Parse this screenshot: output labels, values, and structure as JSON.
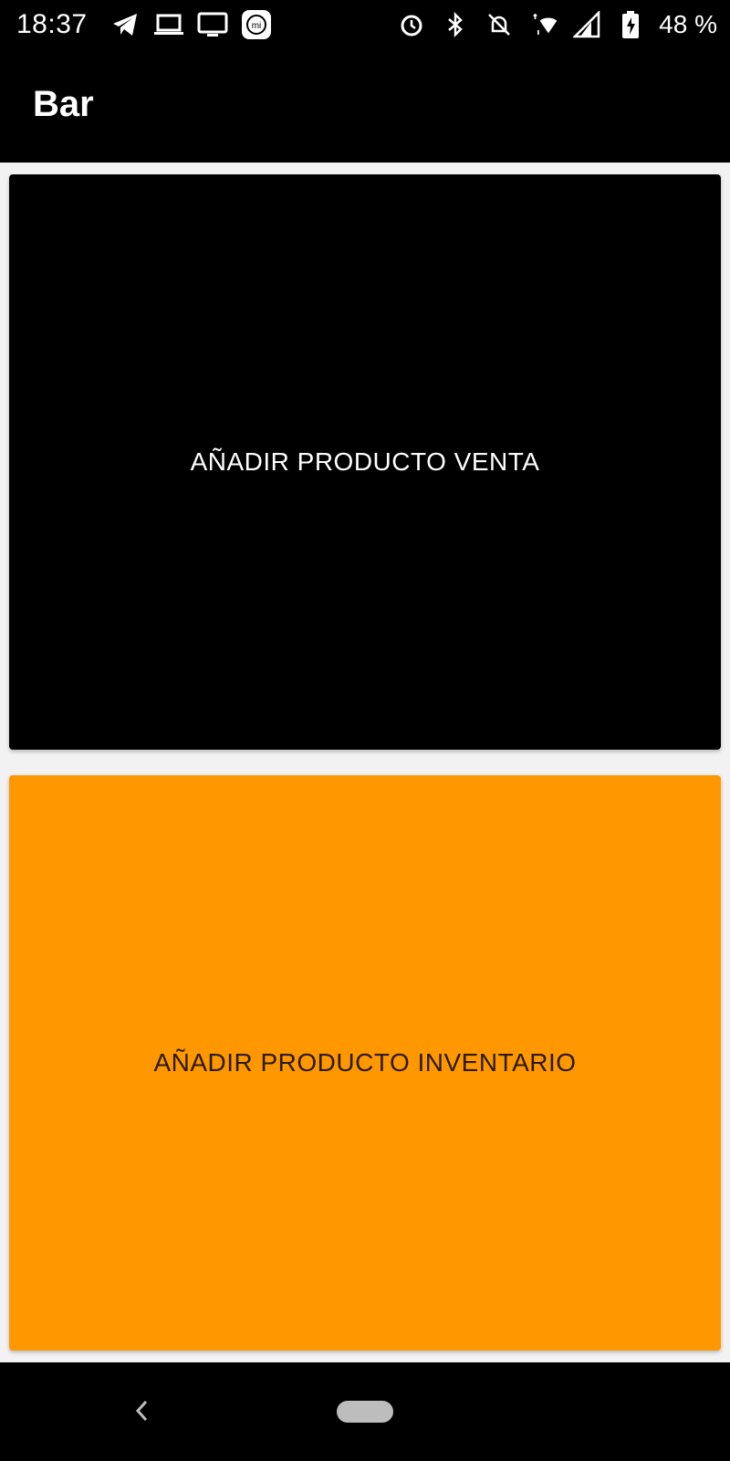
{
  "status_bar": {
    "time": "18:37",
    "battery": "48 %",
    "left_icons": [
      "telegram-icon",
      "laptop-icon",
      "monitor-icon",
      "mi-icon"
    ],
    "right_icons": [
      "alarm-icon",
      "bluetooth-icon",
      "notifications-off-icon",
      "wifi-icon",
      "signal-icon",
      "battery-icon"
    ]
  },
  "app_bar": {
    "title": "Bar"
  },
  "cards": {
    "sale": {
      "label": "AÑADIR PRODUCTO VENTA",
      "color": "#000000"
    },
    "inventory": {
      "label": "AÑADIR PRODUCTO INVENTARIO",
      "color": "#FF9800"
    }
  },
  "nav_bar": {
    "icons": [
      "back-icon",
      "home-pill-icon"
    ]
  }
}
